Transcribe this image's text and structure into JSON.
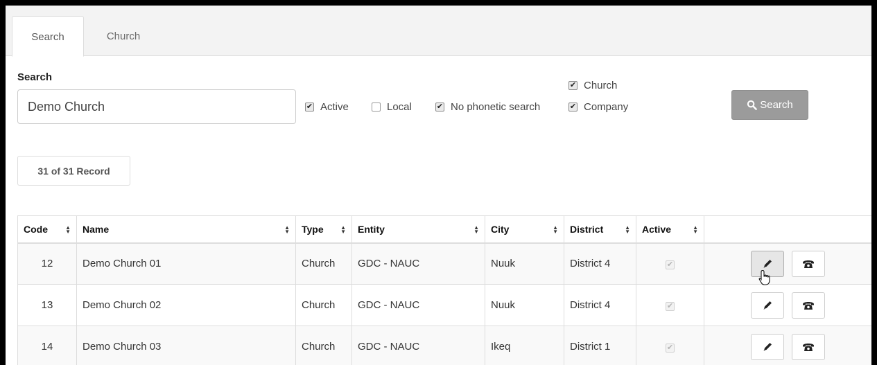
{
  "tabs": [
    {
      "label": "Search",
      "active": true
    },
    {
      "label": "Church",
      "active": false
    }
  ],
  "search": {
    "label": "Search",
    "value": "Demo Church"
  },
  "filters": {
    "active": {
      "label": "Active",
      "checked": true
    },
    "local": {
      "label": "Local",
      "checked": false
    },
    "no_phonetic": {
      "label": "No phonetic search",
      "checked": true
    },
    "church": {
      "label": "Church",
      "checked": true
    },
    "company": {
      "label": "Company",
      "checked": true
    }
  },
  "search_button": {
    "label": "Search",
    "icon": "search-icon"
  },
  "record_count": "31 of 31 Record",
  "table": {
    "columns": [
      "Code",
      "Name",
      "Type",
      "Entity",
      "City",
      "District",
      "Active"
    ],
    "rows": [
      {
        "code": "12",
        "name": "Demo Church 01",
        "type": "Church",
        "entity": "GDC - NAUC",
        "city": "Nuuk",
        "district": "District 4",
        "active": true
      },
      {
        "code": "13",
        "name": "Demo Church 02",
        "type": "Church",
        "entity": "GDC - NAUC",
        "city": "Nuuk",
        "district": "District 4",
        "active": true
      },
      {
        "code": "14",
        "name": "Demo Church 03",
        "type": "Church",
        "entity": "GDC - NAUC",
        "city": "Ikeq",
        "district": "District 1",
        "active": true
      }
    ]
  },
  "colors": {
    "search_button_bg": "#9b9b9b",
    "frame_border": "#000000",
    "tabbar_bg": "#f3f3f3"
  }
}
